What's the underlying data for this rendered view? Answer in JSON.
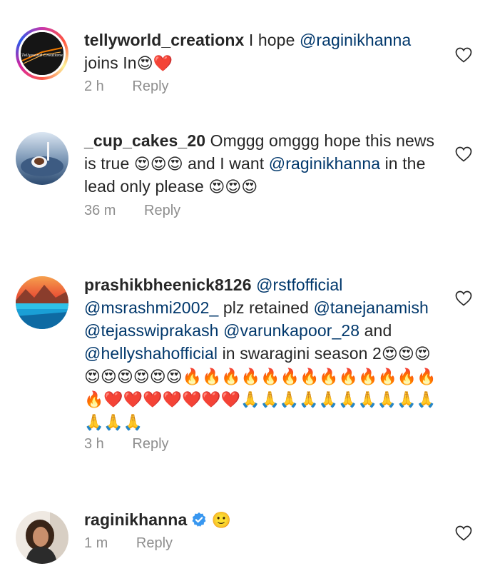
{
  "comments": [
    {
      "username": "tellyworld_creationx",
      "avatar_text": "Tellyworld Creations",
      "segments": [
        {
          "t": "text",
          "v": " I hope "
        },
        {
          "t": "mention",
          "v": "@raginikhanna"
        },
        {
          "t": "text",
          "v": " joins In"
        },
        {
          "t": "emoji",
          "v": "😍❤️"
        }
      ],
      "time": "2 h",
      "reply": "Reply"
    },
    {
      "username": "_cup_cakes_20",
      "segments": [
        {
          "t": "text",
          "v": " Omggg omggg hope this news is true "
        },
        {
          "t": "emoji",
          "v": "😍😍😍"
        },
        {
          "t": "text",
          "v": " and I want "
        },
        {
          "t": "mention",
          "v": "@raginikhanna"
        },
        {
          "t": "text",
          "v": " in the lead only please "
        },
        {
          "t": "emoji",
          "v": "😍😍😍"
        }
      ],
      "time": "36 m",
      "reply": "Reply"
    },
    {
      "username": "prashikbheenick8126",
      "segments": [
        {
          "t": "text",
          "v": " "
        },
        {
          "t": "mention",
          "v": "@rstfofficial"
        },
        {
          "t": "text",
          "v": " "
        },
        {
          "t": "mention",
          "v": "@msrashmi2002_"
        },
        {
          "t": "text",
          "v": " plz retained "
        },
        {
          "t": "mention",
          "v": "@tanejanamish"
        },
        {
          "t": "text",
          "v": " "
        },
        {
          "t": "mention",
          "v": "@tejasswiprakash"
        },
        {
          "t": "text",
          "v": " "
        },
        {
          "t": "mention",
          "v": "@varunkapoor_28"
        },
        {
          "t": "text",
          "v": " and "
        },
        {
          "t": "mention",
          "v": "@hellyshahofficial"
        },
        {
          "t": "text",
          "v": " in swaragini season 2"
        },
        {
          "t": "emoji",
          "v": "😍😍😍😍😍😍😍😍😍🔥🔥🔥🔥🔥🔥🔥🔥🔥🔥🔥🔥🔥🔥❤️❤️❤️❤️❤️❤️❤️🙏🙏🙏🙏🙏🙏🙏🙏🙏🙏🙏🙏🙏"
        }
      ],
      "time": "3 h",
      "reply": "Reply"
    },
    {
      "username": "raginikhanna",
      "verified": true,
      "segments": [
        {
          "t": "text",
          "v": "  "
        },
        {
          "t": "emoji",
          "v": "🙂"
        }
      ],
      "time": "1 m",
      "reply": "Reply"
    }
  ],
  "colors": {
    "text": "#262626",
    "mention": "#00376b",
    "meta": "#8e8e8e",
    "verified": "#3897f0"
  },
  "icons": {
    "like": "heart-outline-icon",
    "verified": "verified-badge-icon"
  }
}
